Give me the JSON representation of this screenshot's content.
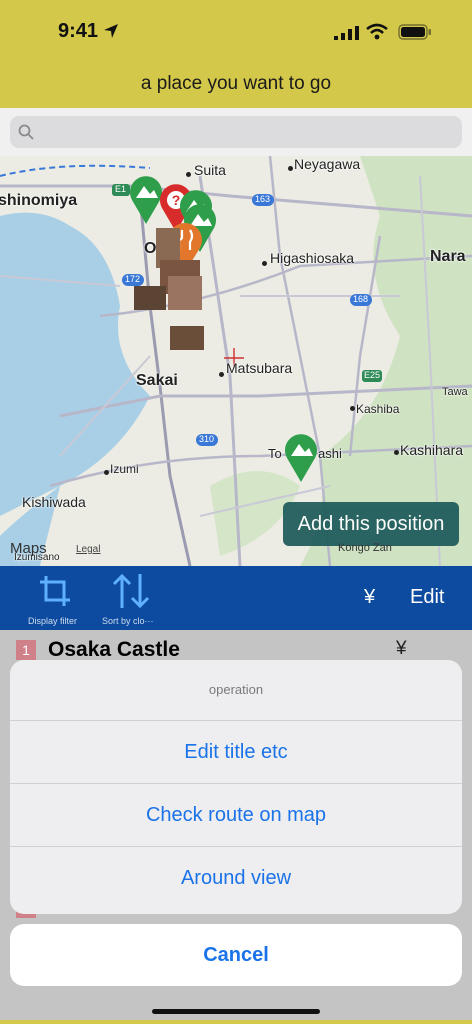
{
  "status": {
    "time": "9:41"
  },
  "header": {
    "title": "a place you want to go"
  },
  "search": {
    "placeholder": ""
  },
  "map": {
    "places": {
      "suita": "Suita",
      "neyagawa": "Neyagawa",
      "nishinomiya": "shinomiya",
      "osaka": "Osaka",
      "higashiosaka": "Higashiosaka",
      "nara": "Nara",
      "sakai": "Sakai",
      "matsubara": "Matsubara",
      "kashiba": "Kashiba",
      "tawa": "Tawa",
      "tondabayashi_a": "To",
      "tondabayashi_b": "ashi",
      "kashihara": "Kashihara",
      "izumi": "Izumi",
      "kishiwada": "Kishiwada",
      "izumisano": "Izumisano",
      "kongo": "Kongo Zan"
    },
    "road_labels": {
      "e1": "E1",
      "r163": "163",
      "r172": "172",
      "r168": "168",
      "e25": "E25",
      "r310": "310"
    },
    "add_position_label": "Add this position",
    "maps_label": "Maps",
    "legal_label": "Legal"
  },
  "toolbar": {
    "display_filter_label": "Display filter",
    "sort_label": "Sort by clo···",
    "yen_label": "¥",
    "edit_label": "Edit"
  },
  "list": {
    "rows": [
      {
        "number": "1",
        "title": "Osaka Castle",
        "price": "¥"
      }
    ]
  },
  "action_sheet": {
    "title": "operation",
    "items": [
      "Edit title etc",
      "Check route on map",
      "Around view"
    ],
    "cancel_label": "Cancel"
  },
  "colors": {
    "header_bg": "#d4c84a",
    "toolbar_bg": "#0d4ba0",
    "accent": "#1a73e8"
  }
}
